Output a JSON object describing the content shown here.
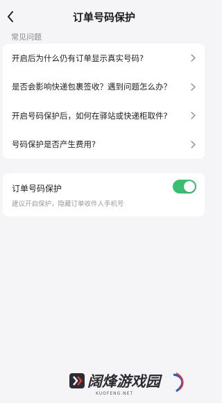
{
  "header": {
    "title": "订单号码保护"
  },
  "faq": {
    "section_label": "常见问题",
    "items": [
      {
        "label": "开启后为什么仍有订单显示真实号码?"
      },
      {
        "label": "是否会影响快递包裹签收？遇到问题怎么办？"
      },
      {
        "label": "开启号码保护后，如何在驿站或快递柜取件?"
      },
      {
        "label": "号码保护是否产生费用?"
      }
    ]
  },
  "setting": {
    "title": "订单号码保护",
    "description": "建议开启保护，隐藏订单收件人手机号",
    "enabled": true,
    "toggle_color": "#3bbd72"
  },
  "watermark": {
    "text": "阔烽游戏园",
    "sub": "KUOFENG.NET"
  }
}
